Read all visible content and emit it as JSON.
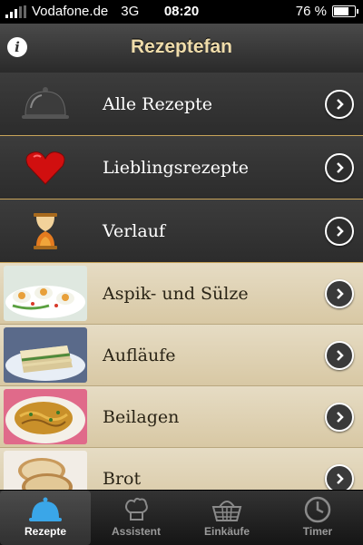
{
  "status": {
    "carrier": "Vodafone.de",
    "network": "3G",
    "time": "08:20",
    "battery": "76 %",
    "battery_level": 0.76
  },
  "nav": {
    "title": "Rezeptefan",
    "info_icon": "info-icon"
  },
  "main_items": [
    {
      "label": "Alle Rezepte",
      "icon": "cloche-icon"
    },
    {
      "label": "Lieblingsrezepte",
      "icon": "heart-icon"
    },
    {
      "label": "Verlauf",
      "icon": "hourglass-icon"
    }
  ],
  "categories": [
    {
      "label": "Aspik- und Sülze"
    },
    {
      "label": "Aufläufe"
    },
    {
      "label": "Beilagen"
    },
    {
      "label": "Brot"
    }
  ],
  "tabs": [
    {
      "label": "Rezepte",
      "icon": "cloche-icon",
      "active": true
    },
    {
      "label": "Assistent",
      "icon": "chef-hat-icon",
      "active": false
    },
    {
      "label": "Einkäufe",
      "icon": "basket-icon",
      "active": false
    },
    {
      "label": "Timer",
      "icon": "clock-icon",
      "active": false
    }
  ],
  "colors": {
    "title": "#efdcaa",
    "separator": "#c8a45a",
    "parchment": "#e6dcc4",
    "heart": "#d10f0f"
  }
}
